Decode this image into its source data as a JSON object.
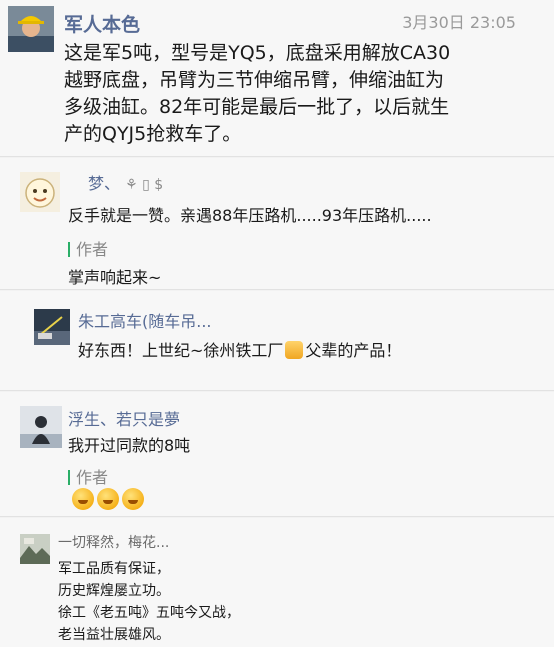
{
  "comments": [
    {
      "name": "军人本色",
      "time": "3月30日 23:05",
      "text": "这是军5吨，型号是YQ5，底盘采用解放CA30\n越野底盘，吊臂为三节伸缩吊臂，伸缩油缸为\n多级油缸。82年可能是最后一批了，以后就生\n产的QYJ5抢救车了。"
    },
    {
      "name": "梦、",
      "text": "反手就是一赞。亲遇88年压路机.....93年压路机.....",
      "reply_label": "作者",
      "reply_text": "掌声响起来~"
    },
    {
      "name": "朱工高车(随车吊...",
      "text_before": "好东西！上世纪~徐州铁工厂",
      "text_after": "父辈的产品！"
    },
    {
      "name": "浮生、若只是夢",
      "text": "我开过同款的8吨",
      "reply_label": "作者"
    },
    {
      "name": "一切释然，梅花...",
      "text": "军工品质有保证，\n历史辉煌屡立功。\n徐工《老五吨》五吨今又战，\n老当益壮展雄风。"
    }
  ],
  "icons": [
    "avatar-soldier",
    "avatar-cartoon",
    "avatar-crane",
    "avatar-person",
    "avatar-landscape",
    "thumbs-up-emoji",
    "laughing-emoji"
  ],
  "colors": {
    "name": "#576b95",
    "reply_bar": "#2aae67",
    "background": "#f7f7f7"
  }
}
